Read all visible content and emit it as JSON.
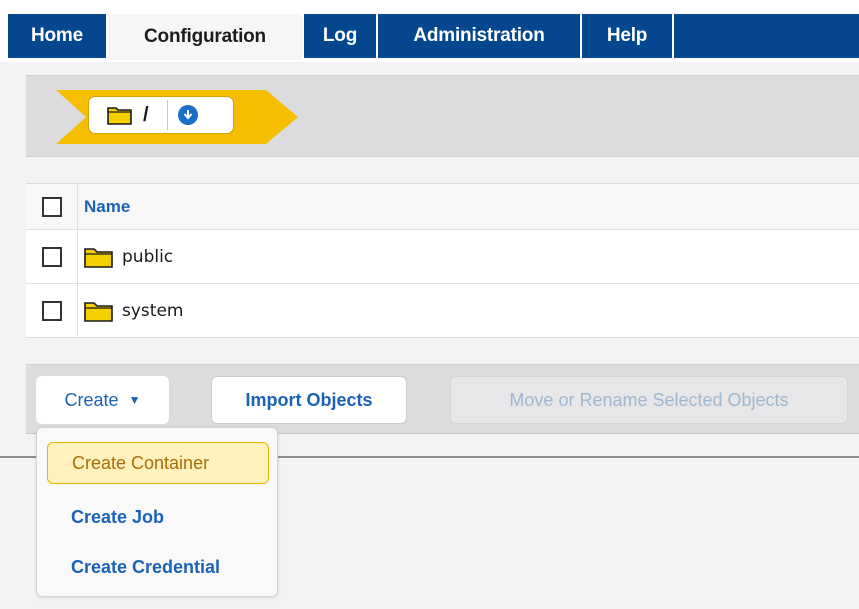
{
  "nav": {
    "tabs": [
      {
        "label": "Home"
      },
      {
        "label": "Configuration",
        "active": true
      },
      {
        "label": "Log"
      },
      {
        "label": "Administration"
      },
      {
        "label": "Help"
      }
    ]
  },
  "breadcrumb": {
    "path": "/",
    "icons": [
      "folder-icon",
      "circle-down-icon"
    ]
  },
  "table": {
    "header": "Name",
    "rows": [
      {
        "name": "public",
        "icon": "folder-icon"
      },
      {
        "name": "system",
        "icon": "folder-icon"
      }
    ]
  },
  "actions": {
    "create_label": "Create",
    "import_label": "Import Objects",
    "move_label": "Move or Rename Selected Objects"
  },
  "create_menu": {
    "items": [
      {
        "label": "Create Container",
        "highlighted": true
      },
      {
        "label": "Create Job"
      },
      {
        "label": "Create Credential"
      }
    ]
  },
  "colors": {
    "nav_bg": "#04478f",
    "accent_blue": "#1a62b5",
    "breadcrumb_chevron": "#f6be00",
    "menu_highlight_bg": "#fff1bd"
  }
}
